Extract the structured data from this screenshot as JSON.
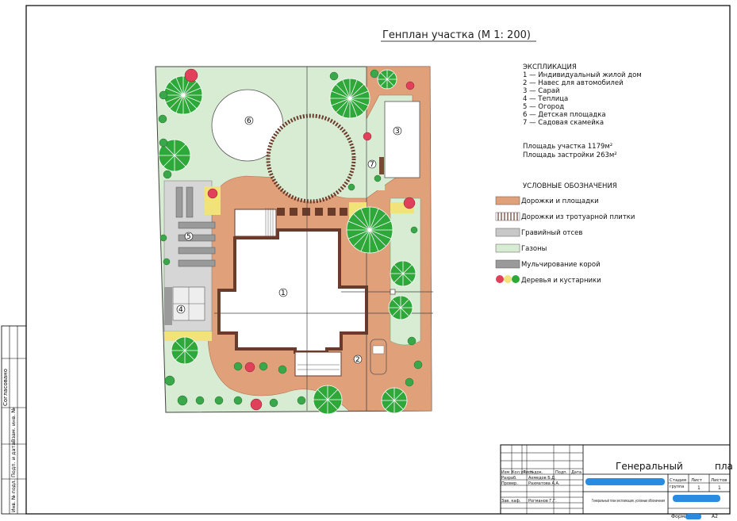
{
  "title": "Генплан участка (М 1: 200)",
  "explication": {
    "heading": "ЭКСПЛИКАЦИЯ",
    "items": [
      "1 — Индивидуальный жилой дом",
      "2 — Навес для автомобилей",
      "3 — Сарай",
      "4 — Теплица",
      "5 — Огород",
      "6 — Детская площадка",
      "7 — Садовая скамейка"
    ]
  },
  "areas": {
    "plot": "Площадь участка 1179м²",
    "built": "Площадь застройки 263м²"
  },
  "legend": {
    "heading": "УСЛОВНЫЕ ОБОЗНАЧЕНИЯ",
    "items": [
      {
        "label": "Дорожки и площадки",
        "color": "#e0a07a"
      },
      {
        "label": "Дорожки из тротуарной плитки",
        "color": "#8a4a3a"
      },
      {
        "label": "Гравийный отсев",
        "color": "#c8c8c8"
      },
      {
        "label": "Газоны",
        "color": "#d7ecd2"
      },
      {
        "label": "Мульчирование корой",
        "color": "#9a9a9a"
      },
      {
        "label": "Деревья и кустарники",
        "color": "#e0405a"
      }
    ]
  },
  "markers": [
    "1",
    "2",
    "3",
    "4",
    "5",
    "6",
    "7"
  ],
  "side_stamp": [
    "Согласовано",
    "Взам. инв. №",
    "Подп. и дата",
    "Инв. № подл."
  ],
  "title_block": {
    "name": "Генеральный",
    "name_end": "пла",
    "headers": [
      "Изм",
      "Кол.уч",
      "Лист",
      "№док.",
      "Подп.",
      "Дата"
    ],
    "rows": [
      {
        "role": "Разраб.",
        "person": "Ахмедов Б.Д."
      },
      {
        "role": "Провер.",
        "person": "Рахматова А.А."
      },
      {
        "role": "Зав. каф.",
        "person": "Рогманов Г.Г."
      }
    ],
    "stage_headers": [
      "Стадия",
      "Лист",
      "Листов"
    ],
    "stage_values": [
      "",
      "1",
      "1"
    ],
    "sheet_desc": "Генеральный план экспликация, условные обозначения",
    "format_label": "Формат",
    "format_value": "А2",
    "org_short": "группа"
  },
  "colors": {
    "path": "#e0a07a",
    "tile": "#8a4a3a",
    "gravel": "#c8c8c8",
    "lawn": "#d7ecd2",
    "mulch": "#9a9a9a",
    "tree_green": "#2fa83a",
    "tree_red": "#e0405a",
    "yellow_shrub": "#f2e27a",
    "blue_redaction": "#2a8be0"
  }
}
